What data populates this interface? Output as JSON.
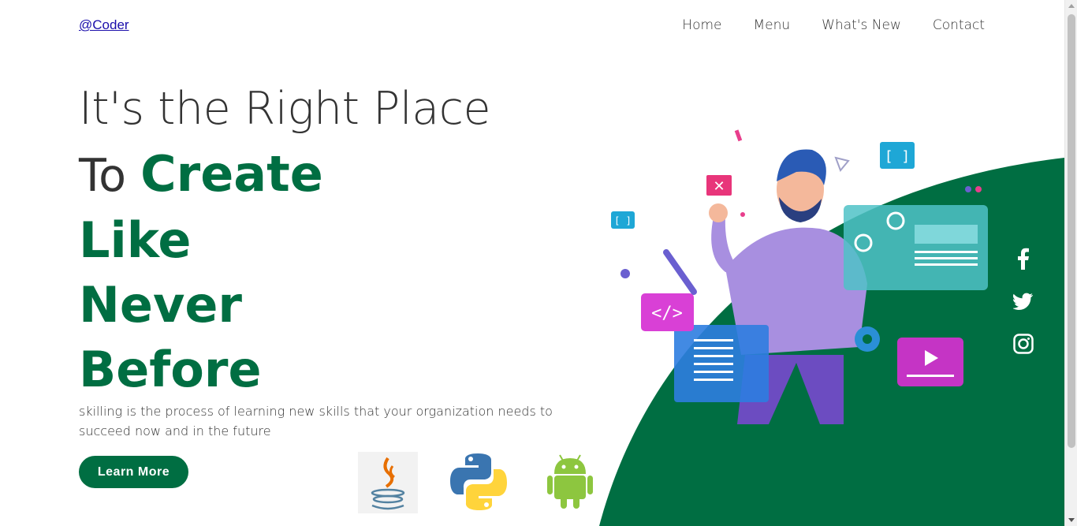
{
  "brand": {
    "logo_text": "@Coder"
  },
  "nav": {
    "items": [
      {
        "label": "Home"
      },
      {
        "label": "Menu"
      },
      {
        "label": "What's New"
      },
      {
        "label": "Contact"
      }
    ]
  },
  "hero": {
    "line1": "It's the Right Place",
    "line2_prefix": "To",
    "line2_green": "Create",
    "line3": "Like",
    "line4": "Never",
    "line5": "Before",
    "description": "skilling is the process of learning new skills that your organization needs to succeed now and in the future",
    "cta_label": "Learn More"
  },
  "social": [
    {
      "icon": "facebook-icon"
    },
    {
      "icon": "twitter-icon"
    },
    {
      "icon": "instagram-icon"
    }
  ],
  "languages": [
    {
      "icon": "java-icon"
    },
    {
      "icon": "python-icon"
    },
    {
      "icon": "android-icon"
    }
  ],
  "colors": {
    "accent": "#006e42",
    "text": "#333333",
    "link": "#1a0dab"
  }
}
